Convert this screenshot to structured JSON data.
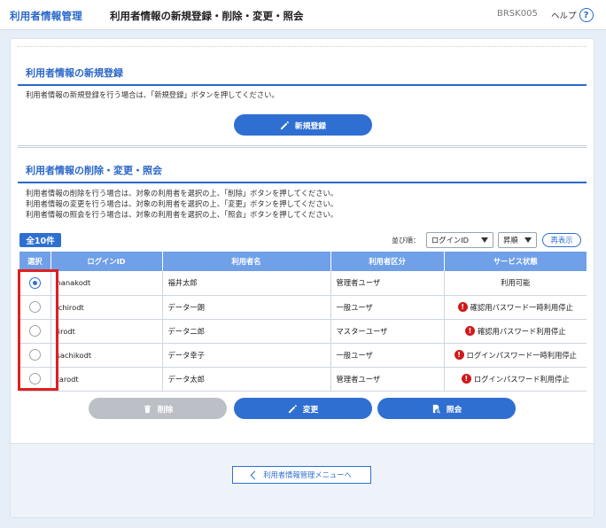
{
  "header": {
    "app_title": "利用者情報管理",
    "page_title": "利用者情報の新規登録・削除・変更・照会",
    "screen_id": "BRSK005",
    "help_label": "ヘルプ",
    "help_icon_glyph": "?"
  },
  "register": {
    "title": "利用者情報の新規登録",
    "description": "利用者情報の新規登録を行う場合は、「新規登録」ボタンを押してください。",
    "button_label": "新規登録"
  },
  "manage": {
    "title": "利用者情報の削除・変更・照会",
    "descriptions": [
      "利用者情報の削除を行う場合は、対象の利用者を選択の上、「削除」ボタンを押してください。",
      "利用者情報の変更を行う場合は、対象の利用者を選択の上、「変更」ボタンを押してください。",
      "利用者情報の照会を行う場合は、対象の利用者を選択の上、「照会」ボタンを押してください。"
    ],
    "count_label": "全10件",
    "sort_label": "並び順：",
    "sort_key": "ログインID",
    "sort_order": "昇順",
    "redisplay_label": "再表示",
    "columns": [
      "選択",
      "ログインID",
      "利用者名",
      "利用者区分",
      "サービス状態"
    ],
    "rows": [
      {
        "login_id": "hanakodt",
        "name": "福井太郎",
        "category": "管理者ユーザ",
        "status": "利用可能",
        "warning": false,
        "selected": true
      },
      {
        "login_id": "ichirodt",
        "name": "データ一朗",
        "category": "一般ユーザ",
        "status": "確認用パスワード一時利用停止",
        "warning": true,
        "selected": false
      },
      {
        "login_id": "jirodt",
        "name": "データ二郎",
        "category": "マスターユーザ",
        "status": "確認用パスワード利用停止",
        "warning": true,
        "selected": false
      },
      {
        "login_id": "sachikodt",
        "name": "データ幸子",
        "category": "一般ユーザ",
        "status": "ログインパスワード一時利用停止",
        "warning": true,
        "selected": false
      },
      {
        "login_id": "tarodt",
        "name": "データ太郎",
        "category": "管理者ユーザ",
        "status": "ログインパスワード利用停止",
        "warning": true,
        "selected": false
      }
    ],
    "warning_glyph": "!",
    "delete_label": "削除",
    "edit_label": "変更",
    "view_label": "照会"
  },
  "footer": {
    "back_label": "利用者情報管理メニューへ"
  },
  "colors": {
    "accent": "#2f6fd1",
    "header_blue": "#6fa0e8",
    "warning_red": "#d01a1a",
    "highlight_red": "#e02020",
    "disabled_gray": "#bcc0c6"
  },
  "icons": {
    "help": "help-icon",
    "register_button": "pencil-icon",
    "edit_button": "pencil-icon",
    "delete_button": "trash-icon",
    "view_button": "document-search-icon",
    "warning": "warning-icon",
    "back": "chevron-left-icon"
  }
}
